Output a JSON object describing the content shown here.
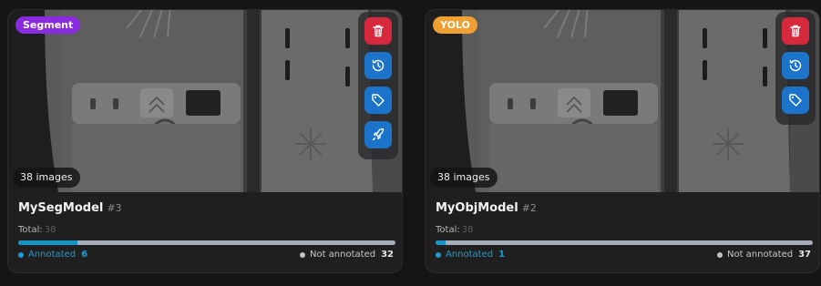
{
  "cards": [
    {
      "badge": "Segment",
      "badge_color": "#8a2be2",
      "image_count": "38 images",
      "name": "MySegModel",
      "version": "#3",
      "total_label": "Total:",
      "total_value": "38",
      "annotated_label": "Annotated",
      "annotated_value": "6",
      "not_annotated_label": "Not annotated",
      "not_annotated_value": "32",
      "annotated_fraction": 0.158,
      "actions": [
        "trash-icon",
        "history-icon",
        "tag-icon",
        "rocket-icon"
      ]
    },
    {
      "badge": "YOLO",
      "badge_color": "#f0a030",
      "image_count": "38 images",
      "name": "MyObjModel",
      "version": "#2",
      "total_label": "Total:",
      "total_value": "38",
      "annotated_label": "Annotated",
      "annotated_value": "1",
      "not_annotated_label": "Not annotated",
      "not_annotated_value": "37",
      "annotated_fraction": 0.026,
      "actions": [
        "trash-icon",
        "history-icon",
        "tag-icon"
      ]
    }
  ]
}
